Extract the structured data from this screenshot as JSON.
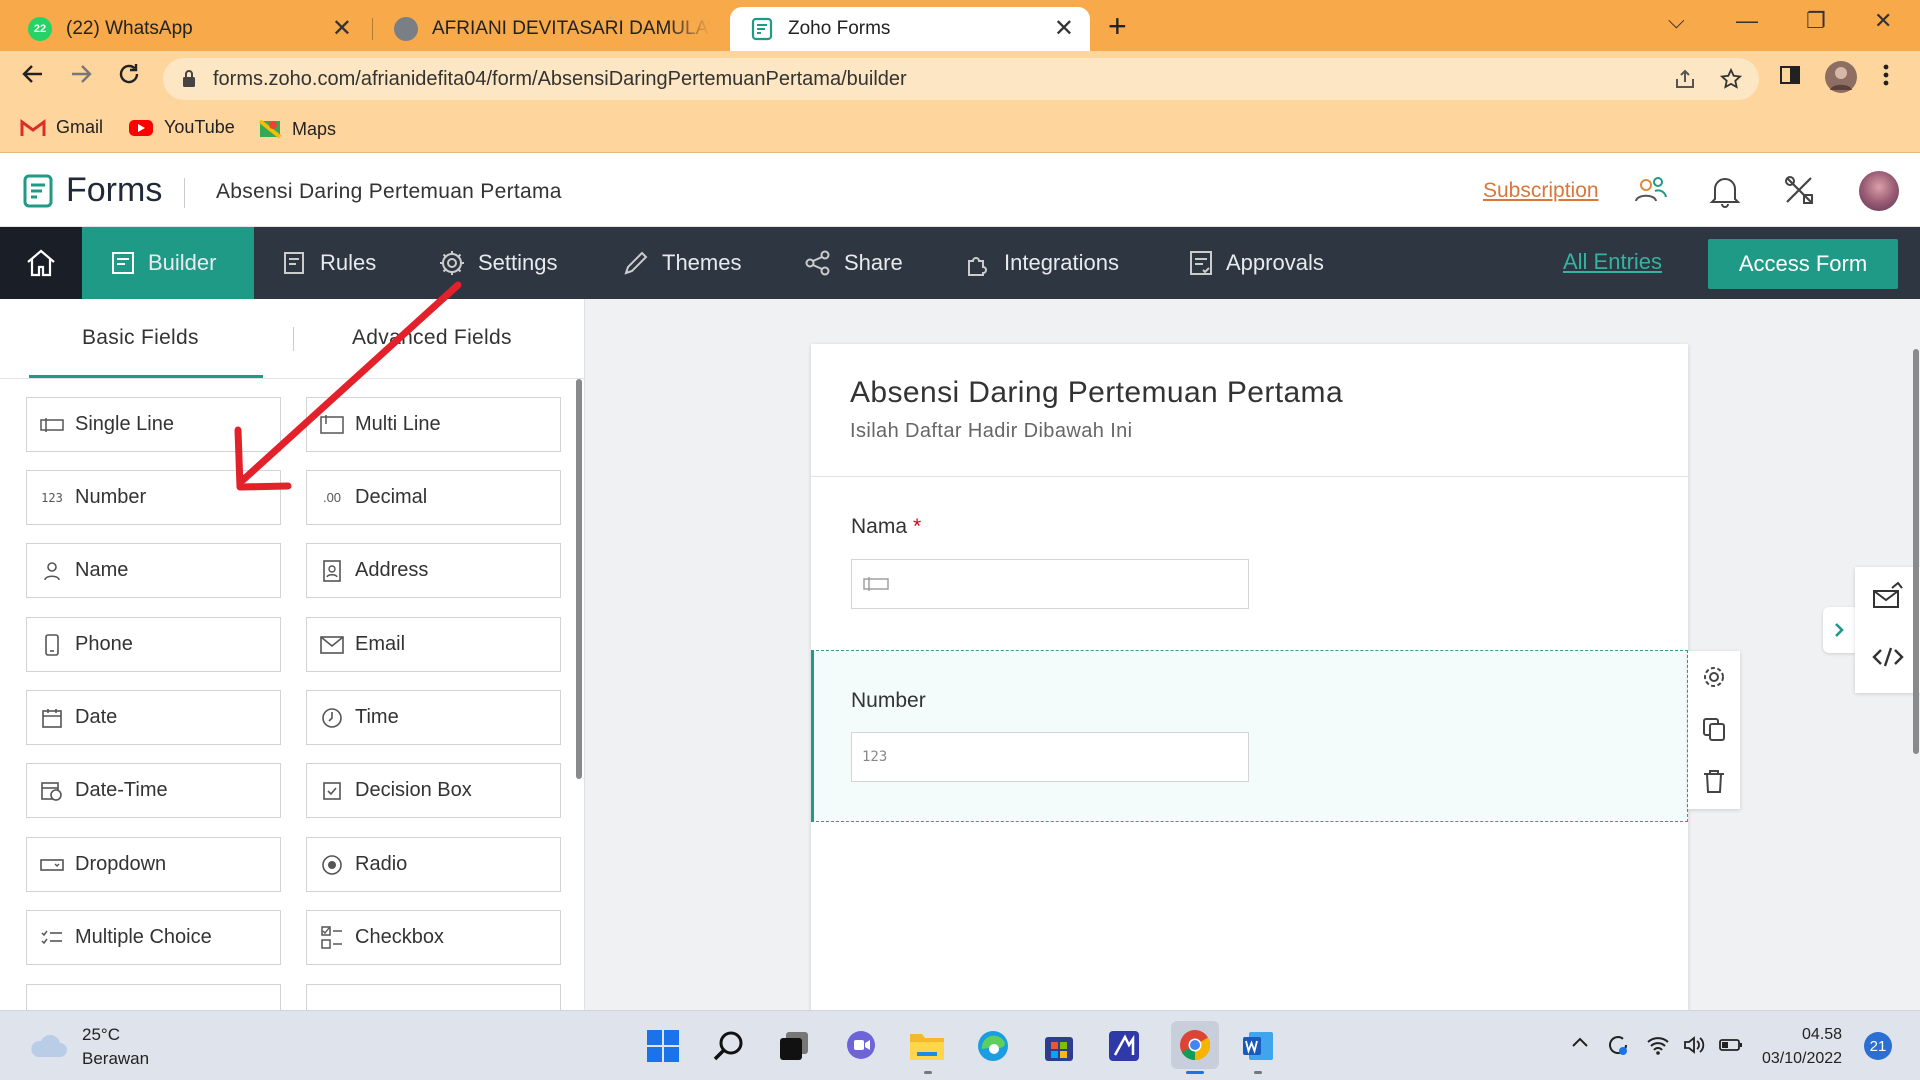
{
  "browser": {
    "tabs": [
      {
        "title": "(22) WhatsApp",
        "badge": "22",
        "close": "✕"
      },
      {
        "title": "AFRIANI DEVITASARI DAMULAWAN",
        "close": ""
      },
      {
        "title": "Zoho Forms",
        "close": "✕"
      }
    ],
    "new_tab": "+",
    "url": "forms.zoho.com/afrianidefita04/form/AbsensiDaringPertemuanPertama/builder",
    "bookmarks": [
      {
        "label": "Gmail"
      },
      {
        "label": "YouTube"
      },
      {
        "label": "Maps"
      }
    ],
    "window_controls": {
      "dropdown": "⌵",
      "minimize": "—",
      "restore": "❐",
      "close": "✕"
    }
  },
  "zoho": {
    "brand": "Forms",
    "form_title": "Absensi Daring Pertemuan Pertama",
    "subscription": "Subscription",
    "nav": [
      {
        "label": "Builder",
        "active": true
      },
      {
        "label": "Rules"
      },
      {
        "label": "Settings"
      },
      {
        "label": "Themes"
      },
      {
        "label": "Share"
      },
      {
        "label": "Integrations"
      },
      {
        "label": "Approvals"
      }
    ],
    "all_entries": "All Entries",
    "access_form": "Access Form",
    "accent": "#1f9a86",
    "nav_bg": "#2e3642"
  },
  "fields_panel": {
    "tabs": [
      {
        "label": "Basic Fields",
        "active": true
      },
      {
        "label": "Advanced Fields"
      }
    ],
    "fields": [
      {
        "label": "Single Line",
        "icon": "single-line-icon"
      },
      {
        "label": "Multi Line",
        "icon": "multi-line-icon"
      },
      {
        "label": "Number",
        "icon": "number-icon",
        "glyph": "123"
      },
      {
        "label": "Decimal",
        "icon": "decimal-icon",
        "glyph": ".00"
      },
      {
        "label": "Name",
        "icon": "person-icon"
      },
      {
        "label": "Address",
        "icon": "address-icon"
      },
      {
        "label": "Phone",
        "icon": "phone-icon"
      },
      {
        "label": "Email",
        "icon": "mail-icon"
      },
      {
        "label": "Date",
        "icon": "calendar-icon"
      },
      {
        "label": "Time",
        "icon": "clock-icon"
      },
      {
        "label": "Date-Time",
        "icon": "calendar-clock-icon"
      },
      {
        "label": "Decision Box",
        "icon": "checkbox-icon"
      },
      {
        "label": "Dropdown",
        "icon": "dropdown-icon"
      },
      {
        "label": "Radio",
        "icon": "radio-icon"
      },
      {
        "label": "Multiple Choice",
        "icon": "multiple-choice-icon"
      },
      {
        "label": "Checkbox",
        "icon": "checklist-icon"
      }
    ]
  },
  "form": {
    "title": "Absensi Daring Pertemuan Pertama",
    "subtitle": "Isilah Daftar Hadir Dibawah Ini",
    "fields": [
      {
        "label": "Nama",
        "required": "*",
        "type": "single-line"
      },
      {
        "label": "Number",
        "type": "number",
        "glyph": "123"
      }
    ]
  },
  "taskbar": {
    "weather_temp": "25°C",
    "weather_desc": "Berawan",
    "time": "04.58",
    "date": "03/10/2022",
    "notifications": "21"
  }
}
